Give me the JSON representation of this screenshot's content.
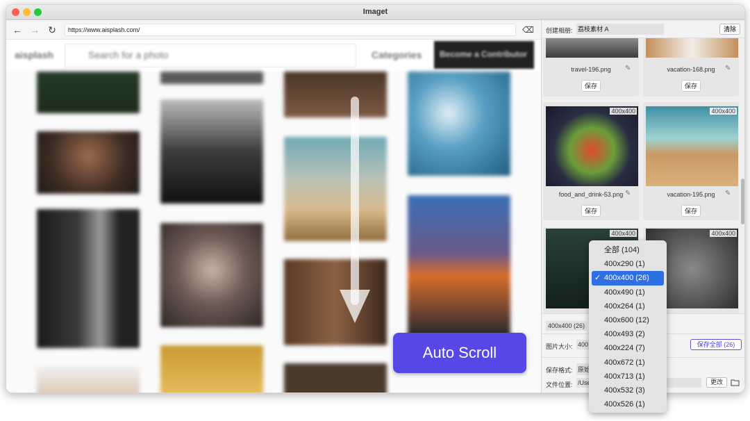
{
  "window": {
    "title": "Imaget"
  },
  "browser": {
    "url": "https://www.aisplash.com/",
    "back_icon": "←",
    "forward_icon": "→",
    "reload_icon": "↻",
    "eraser_icon": "⌫"
  },
  "site": {
    "logo": "aisplash",
    "search": "Search for a photo",
    "categories": "Categories",
    "cta": "Become a Contributor"
  },
  "overlay": {
    "auto_scroll": "Auto Scroll"
  },
  "panel": {
    "album_label": "创建相册:",
    "album_value": "荔枝素材 A",
    "clear": "清除",
    "cards": [
      {
        "name": "travel-196.png",
        "save": "保存",
        "badge": ""
      },
      {
        "name": "vacation-168.png",
        "save": "保存",
        "badge": ""
      },
      {
        "name": "food_and_drink-53.png",
        "save": "保存",
        "badge": "400x400"
      },
      {
        "name": "vacation-195.png",
        "save": "保存",
        "badge": "400x400"
      },
      {
        "name": "",
        "save": "",
        "badge": "400x400"
      },
      {
        "name": "",
        "save": "",
        "badge": "400x400"
      }
    ],
    "size_filter": "400x400 (26)",
    "pic_size_label": "图片大小:",
    "pic_size_value": "400",
    "save_all": "保存全部 (26)",
    "format_label": "保存格式:",
    "format_value": "原始",
    "location_label": "文件位置:",
    "location_value": "/Use",
    "change": "更改",
    "folder_icon": "folder"
  },
  "dropdown": {
    "options": [
      "全部 (104)",
      "400x290 (1)",
      "400x400 (26)",
      "400x490 (1)",
      "400x264 (1)",
      "400x600 (12)",
      "400x493 (2)",
      "400x224 (7)",
      "400x672 (1)",
      "400x713 (1)",
      "400x532 (3)",
      "400x526 (1)"
    ],
    "selected": "400x400 (26)"
  },
  "colors": {
    "accent": "#5548e6",
    "selection": "#2f6fe4",
    "save_all_border": "#5b4fe0"
  }
}
